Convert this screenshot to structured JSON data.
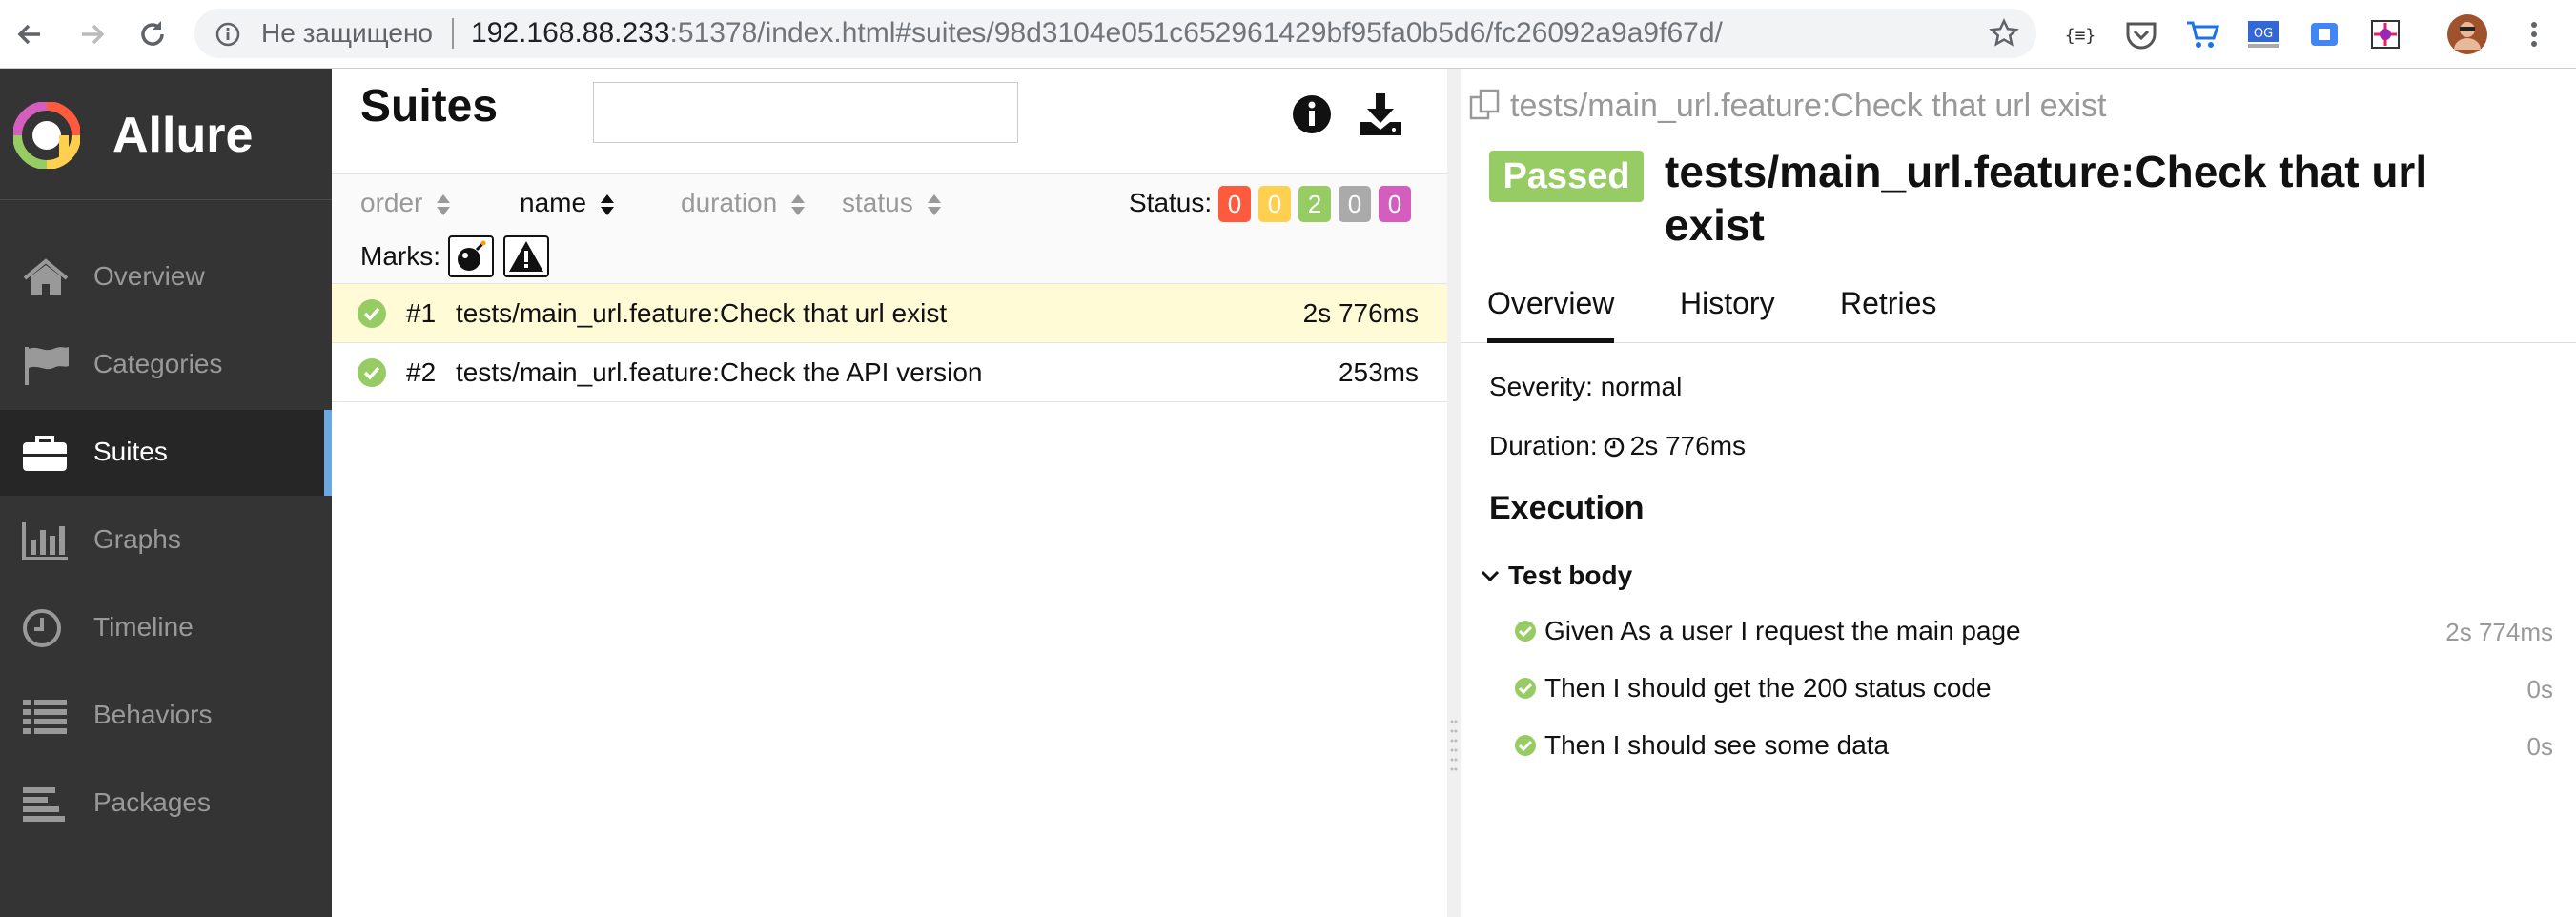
{
  "browser": {
    "security_label": "Не защищено",
    "url_host": "192.168.88.233",
    "url_rest": ":51378/index.html#suites/98d3104e051c652961429bf95fa0b5d6/fc26092a9a9f67d/",
    "icons": [
      "back-icon",
      "forward-icon",
      "reload-icon",
      "info-icon",
      "star-icon",
      "json-extension-icon",
      "pocket-icon",
      "cart-extension-icon",
      "og-extension-icon",
      "screen-extension-icon",
      "color-extension-icon",
      "profile-avatar",
      "more-menu-icon"
    ]
  },
  "sidebar": {
    "brand": "Allure",
    "items": [
      {
        "label": "Overview",
        "icon": "home-icon"
      },
      {
        "label": "Categories",
        "icon": "flag-icon"
      },
      {
        "label": "Suites",
        "icon": "briefcase-icon",
        "active": true
      },
      {
        "label": "Graphs",
        "icon": "bar-chart-icon"
      },
      {
        "label": "Timeline",
        "icon": "clock-icon"
      },
      {
        "label": "Behaviors",
        "icon": "list-icon"
      },
      {
        "label": "Packages",
        "icon": "align-left-icon"
      }
    ],
    "colors": {
      "background": "#343434",
      "active_indicator": "#6da7e0"
    }
  },
  "suites": {
    "title": "Suites",
    "search_value": "",
    "columns": [
      "order",
      "name",
      "duration",
      "status"
    ],
    "active_sort": "name",
    "status_label": "Status:",
    "status_badges": [
      {
        "count": "0",
        "color": "#fd5a3e"
      },
      {
        "count": "0",
        "color": "#ffd050"
      },
      {
        "count": "2",
        "color": "#97cc64"
      },
      {
        "count": "0",
        "color": "#aaaaaa"
      },
      {
        "count": "0",
        "color": "#d35ebe"
      }
    ],
    "marks_label": "Marks:",
    "marks": [
      "flaky-bomb-icon",
      "warning-icon"
    ],
    "rows": [
      {
        "num": "#1",
        "name": "tests/main_url.feature:Check that url exist",
        "duration": "2s 776ms",
        "selected": true
      },
      {
        "num": "#2",
        "name": "tests/main_url.feature:Check the API version",
        "duration": "253ms",
        "selected": false
      }
    ]
  },
  "detail": {
    "breadcrumb": "tests/main_url.feature:Check that url exist",
    "status": "Passed",
    "title": "tests/main_url.feature:Check that url exist",
    "tabs": [
      "Overview",
      "History",
      "Retries"
    ],
    "active_tab": "Overview",
    "severity": "Severity: normal",
    "duration_label": "Duration:",
    "duration_value": "2s 776ms",
    "execution_heading": "Execution",
    "test_body_label": "Test body",
    "steps": [
      {
        "text": "Given As a user I request the main page",
        "duration": "2s 774ms"
      },
      {
        "text": "Then I should get the 200 status code",
        "duration": "0s"
      },
      {
        "text": "Then I should see some data",
        "duration": "0s"
      }
    ]
  }
}
